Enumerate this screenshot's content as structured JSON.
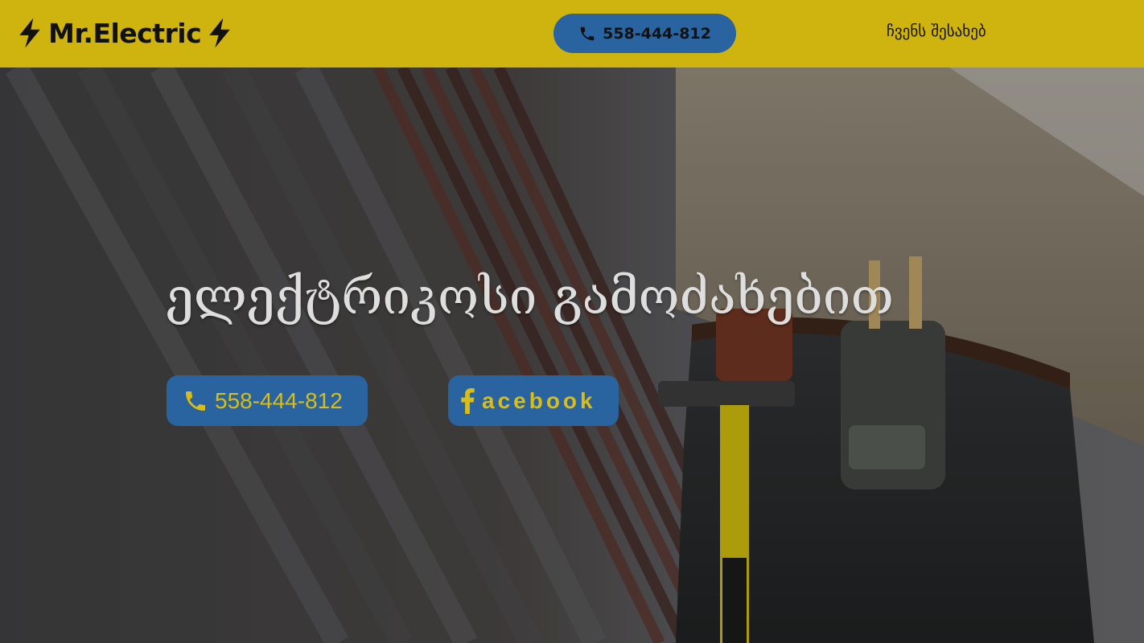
{
  "header": {
    "brand": "Mr.Electric",
    "phone_label": "558-444-812",
    "about_label": "ჩვენს შესახებ"
  },
  "hero": {
    "title": "ელექტრიკოსი გამოძახებით",
    "phone_button_label": "558-444-812",
    "facebook_button_label": "acebook"
  },
  "icons": {
    "brand_left": "lightning-bolt",
    "brand_right": "lightning-bolt",
    "nav_phone": "phone-handset",
    "hero_phone": "phone-handset",
    "hero_facebook": "facebook-f"
  },
  "colors": {
    "header_bg": "#cfb30e",
    "button_bg": "#2a64a0",
    "button_text": "#d8bc17",
    "hero_title": "#dedede"
  }
}
